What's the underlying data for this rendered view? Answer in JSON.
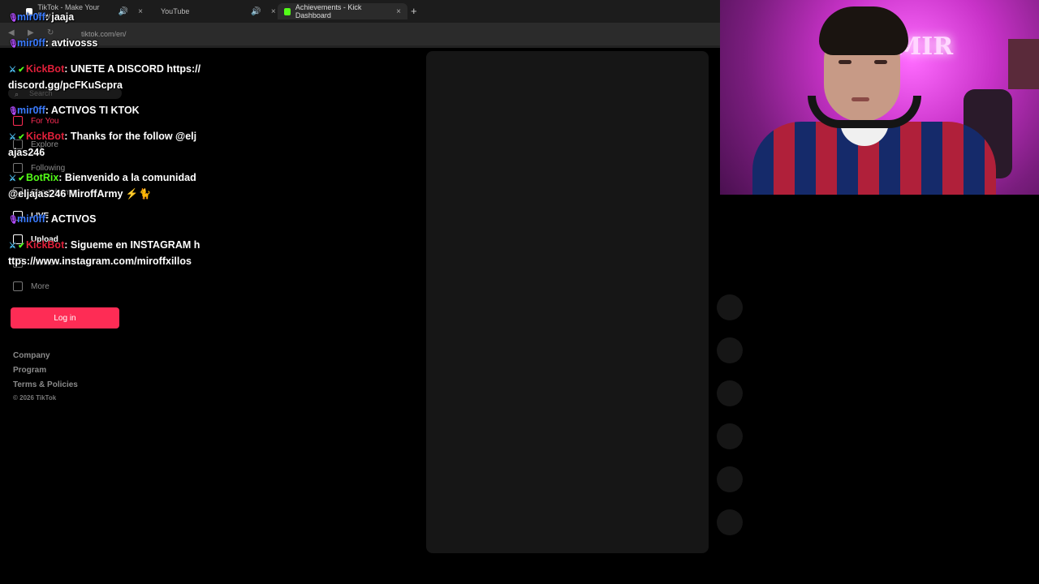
{
  "browser": {
    "tabs": [
      {
        "label": "TikTok - Make Your Day",
        "active": false,
        "favicon_color": "#ffffff"
      },
      {
        "label": "YouTube",
        "active": false,
        "favicon_color": "#ff0000"
      },
      {
        "label": "Achievements - Kick Dashboard",
        "active": true,
        "favicon_color": "#53fc18"
      }
    ],
    "close_glyph": "×",
    "speaker_glyph": "🔊",
    "new_tab_glyph": "+",
    "url": "tiktok.com/en/"
  },
  "tiktok_sidebar": {
    "search_placeholder": "Search",
    "items": [
      {
        "label": "For You",
        "icon": "home-icon",
        "style": "red"
      },
      {
        "label": "Explore",
        "icon": "compass-icon",
        "style": "normal"
      },
      {
        "label": "Following",
        "icon": "following-icon",
        "style": "normal"
      },
      {
        "label": "Short dramas",
        "icon": "drama-icon",
        "style": "normal"
      },
      {
        "label": "LIVE",
        "icon": "live-icon",
        "style": "bright"
      },
      {
        "label": "Upload",
        "icon": "plus-square-icon",
        "style": "bright"
      },
      {
        "label": "Profile",
        "icon": "profile-icon",
        "style": "normal"
      },
      {
        "label": "More",
        "icon": "more-icon",
        "style": "normal"
      }
    ],
    "login_label": "Log in",
    "footer": [
      "Company",
      "Program",
      "Terms & Policies"
    ],
    "copyright": "© 2026 TikTok"
  },
  "chat": [
    {
      "badges": [
        "mic"
      ],
      "user": "mir0ff",
      "user_color": "purple",
      "text": "jaaja"
    },
    {
      "badges": [
        "mic"
      ],
      "user": "mir0ff",
      "user_color": "purple",
      "text": "avtivosss"
    },
    {
      "badges": [
        "sword",
        "verified"
      ],
      "user": "KickBot",
      "user_color": "red",
      "text": "UNETE A DISCORD https://discord.gg/pcFKuScpra"
    },
    {
      "badges": [
        "mic"
      ],
      "user": "mir0ff",
      "user_color": "purple",
      "text": "ACTIVOS TI KTOK"
    },
    {
      "badges": [
        "sword",
        "verified"
      ],
      "user": "KickBot",
      "user_color": "red",
      "text": "Thanks for the follow @eljajas246"
    },
    {
      "badges": [
        "sword",
        "verified"
      ],
      "user": "BotRix",
      "user_color": "green",
      "text": "Bienvenido a la comunidad @eljajas246 MiroffArmy ⚡🐈"
    },
    {
      "badges": [
        "mic"
      ],
      "user": "mir0ff",
      "user_color": "purple",
      "text": "ACTIVOS"
    },
    {
      "badges": [
        "sword",
        "verified"
      ],
      "user": "KickBot",
      "user_color": "red",
      "text": "Sigueme en INSTAGRAM https://www.instagram.com/miroffxillos"
    }
  ],
  "webcam": {
    "sign_text": "MIR"
  },
  "colors": {
    "tiktok_red": "#fe2c55",
    "kick_green": "#53fc18",
    "username_purple": "#3a7bff",
    "username_red": "#e0203a"
  }
}
